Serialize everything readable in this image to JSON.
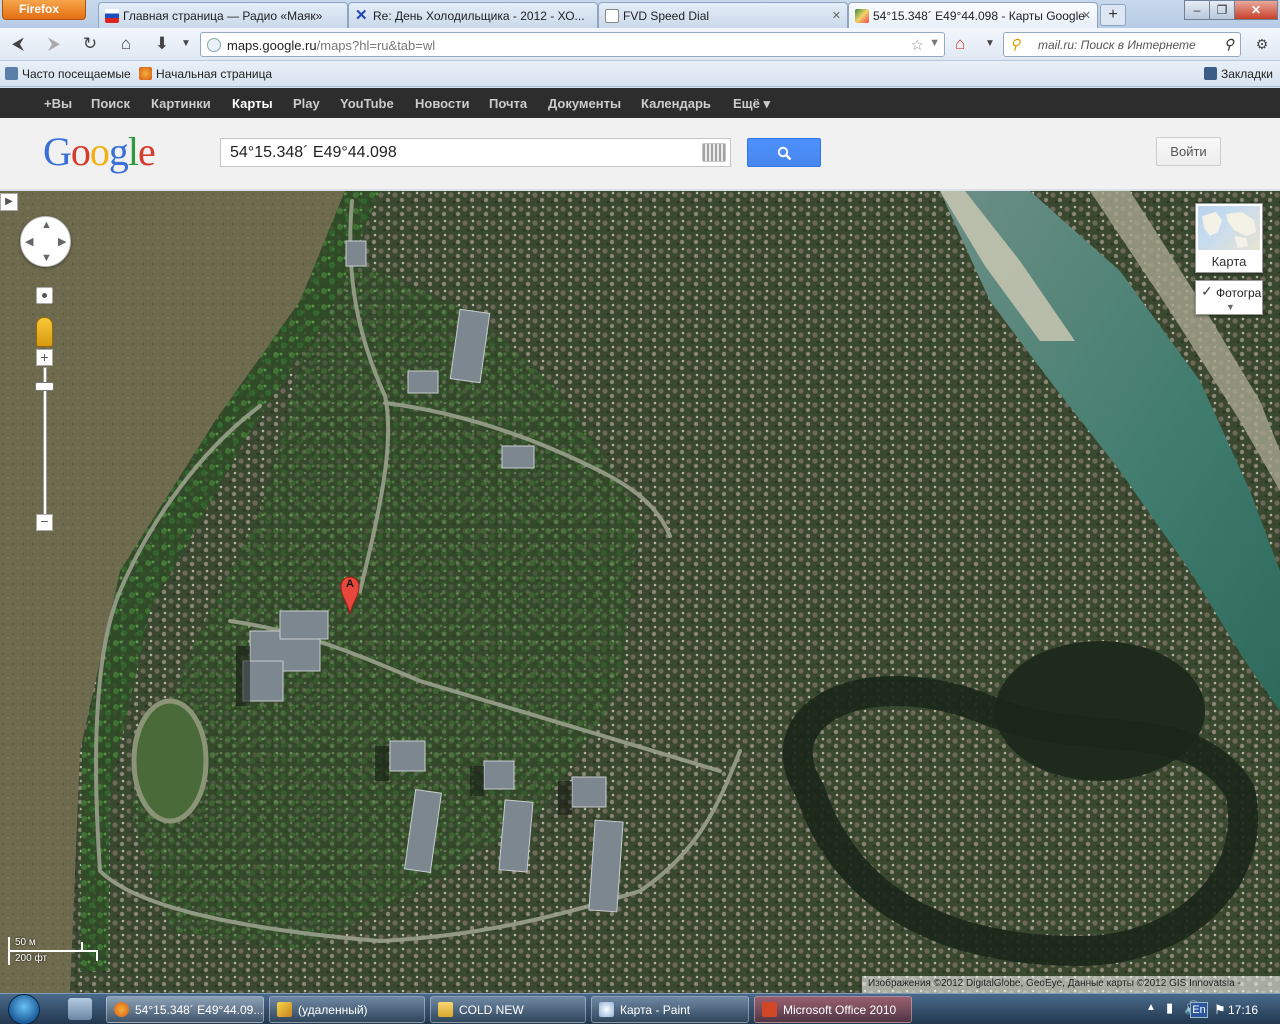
{
  "browser": {
    "menu_button": "Firefox",
    "tabs": [
      {
        "label": "Главная страница — Радио «Маяк»"
      },
      {
        "label": "Re: День Холодильщика - 2012 - ХО..."
      },
      {
        "label": "FVD Speed Dial"
      },
      {
        "label": "54°15.348´ E49°44.098 - Карты Google"
      }
    ],
    "url_domain": "maps.google.ru",
    "url_path": "/maps?hl=ru&tab=wl",
    "search_placeholder": "mail.ru: Поиск в Интернете",
    "bookmarks": [
      "Часто посещаемые",
      "Начальная страница"
    ],
    "bookmarks_menu": "Закладки"
  },
  "google": {
    "bar": [
      "+Вы",
      "Поиск",
      "Картинки",
      "Карты",
      "Play",
      "YouTube",
      "Новости",
      "Почта",
      "Документы",
      "Календарь",
      "Ещё ▾"
    ],
    "logo_letters": [
      "G",
      "o",
      "o",
      "g",
      "l",
      "e"
    ],
    "search_value": "54°15.348´ E49°44.098",
    "signin_label": "Войти"
  },
  "map": {
    "maptype_label": "Карта",
    "layer_label": "Фотогра",
    "scale_metric": "50 м",
    "scale_imperial": "200 фт",
    "marker_letter": "A",
    "attribution": "Изображения ©2012 DigitalGlobe, GeoEye, Данные карты ©2012 GIS Innovatsia -"
  },
  "taskbar": {
    "items": [
      "54°15.348´ E49°44.09...",
      "(удаленный)",
      "COLD NEW",
      "Карта - Paint",
      "Microsoft Office 2010"
    ],
    "lang": "En",
    "time": "17:16"
  },
  "colors": {
    "google_bar": "#2d2d2d",
    "search_button": "#4d90fe",
    "marker": "#e8473c"
  }
}
